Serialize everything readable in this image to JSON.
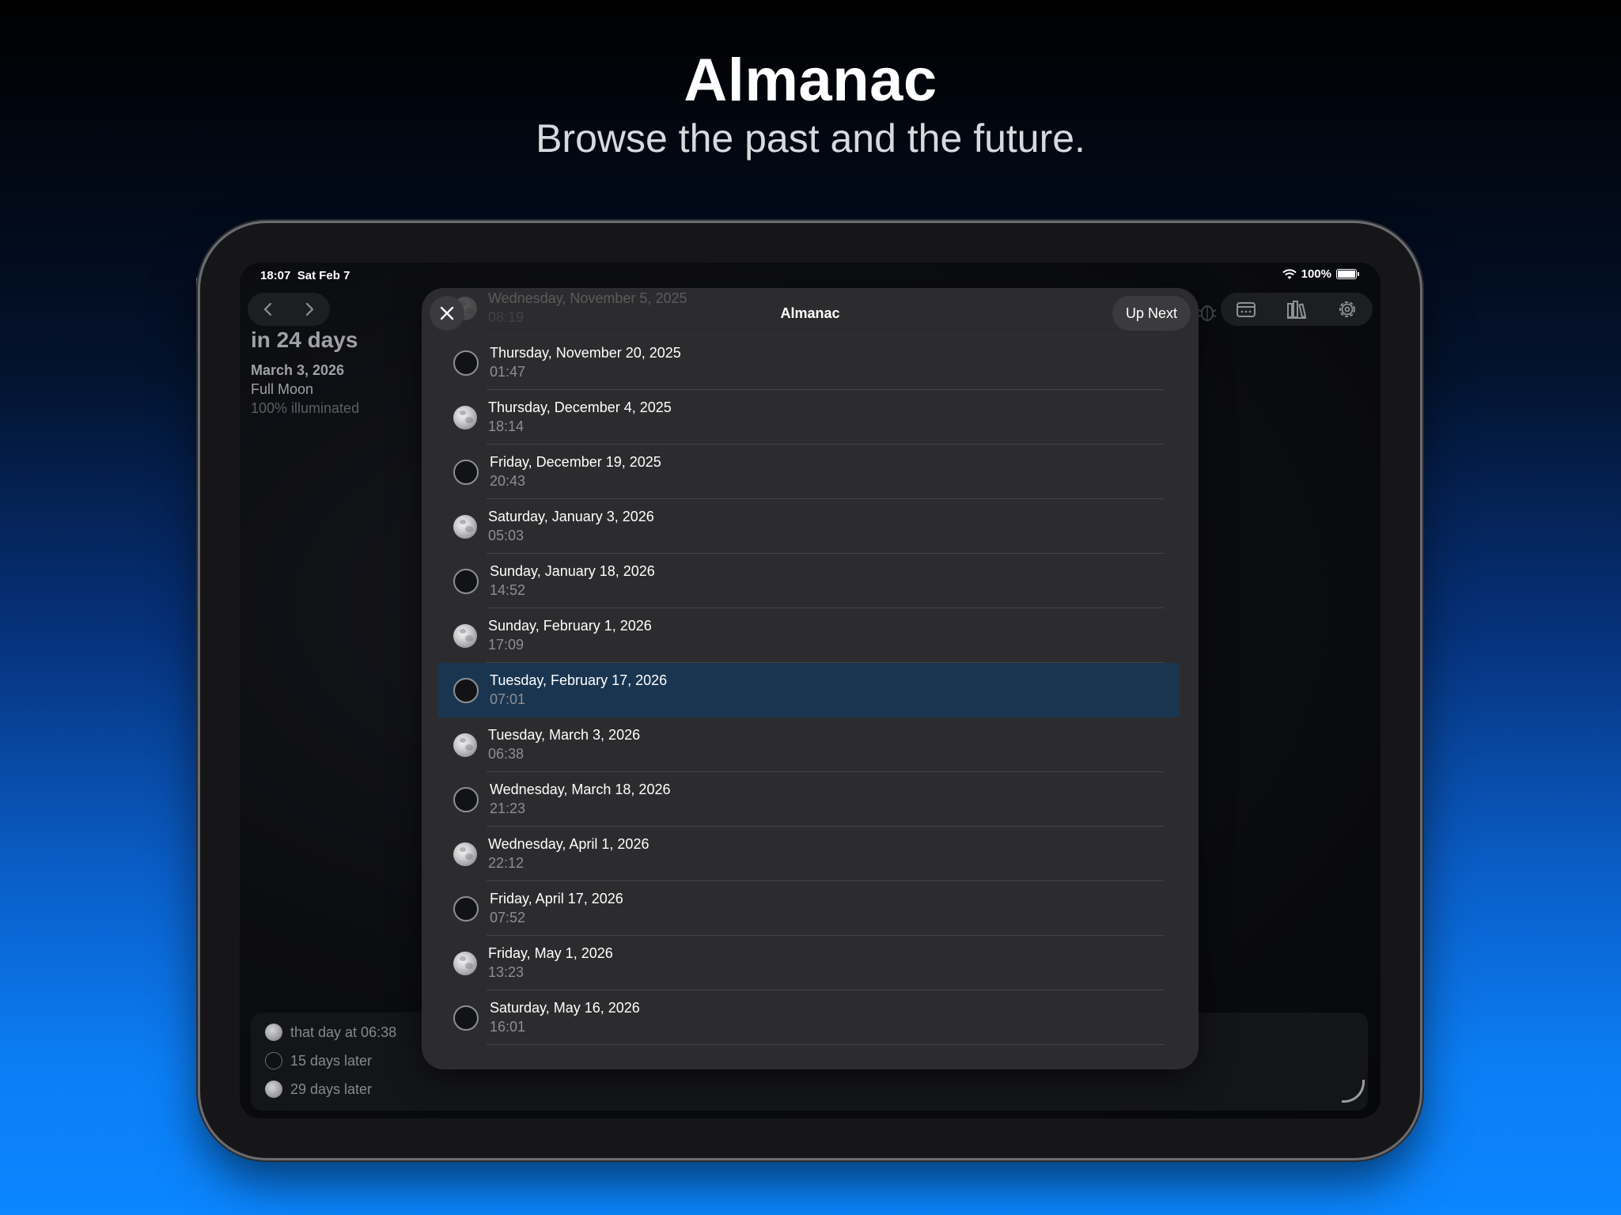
{
  "promo": {
    "title": "Almanac",
    "subtitle": "Browse the past and the future."
  },
  "status_bar": {
    "time": "18:07",
    "date": "Sat Feb 7",
    "battery": "100%"
  },
  "background_view": {
    "countdown": "in 24 days",
    "date": "March 3, 2026",
    "phase": "Full Moon",
    "illumination": "100% illuminated",
    "footer": [
      {
        "icon": "full-moon-icon",
        "label": "that day at 06:38"
      },
      {
        "icon": "new-moon-icon",
        "label": "15 days later"
      },
      {
        "icon": "full-moon-icon",
        "label": "29 days later"
      }
    ]
  },
  "sheet": {
    "title": "Almanac",
    "up_next_label": "Up Next",
    "rows": [
      {
        "date": "Wednesday, November 5, 2025",
        "time": "08:19",
        "phase": "full"
      },
      {
        "date": "Thursday, November 20, 2025",
        "time": "01:47",
        "phase": "new"
      },
      {
        "date": "Thursday, December 4, 2025",
        "time": "18:14",
        "phase": "full"
      },
      {
        "date": "Friday, December 19, 2025",
        "time": "20:43",
        "phase": "new"
      },
      {
        "date": "Saturday, January 3, 2026",
        "time": "05:03",
        "phase": "full"
      },
      {
        "date": "Sunday, January 18, 2026",
        "time": "14:52",
        "phase": "new"
      },
      {
        "date": "Sunday, February 1, 2026",
        "time": "17:09",
        "phase": "full"
      },
      {
        "date": "Tuesday, February 17, 2026",
        "time": "07:01",
        "phase": "new",
        "selected": true
      },
      {
        "date": "Tuesday, March 3, 2026",
        "time": "06:38",
        "phase": "full"
      },
      {
        "date": "Wednesday, March 18, 2026",
        "time": "21:23",
        "phase": "new"
      },
      {
        "date": "Wednesday, April 1, 2026",
        "time": "22:12",
        "phase": "full"
      },
      {
        "date": "Friday, April 17, 2026",
        "time": "07:52",
        "phase": "new"
      },
      {
        "date": "Friday, May 1, 2026",
        "time": "13:23",
        "phase": "full"
      },
      {
        "date": "Saturday, May 16, 2026",
        "time": "16:01",
        "phase": "new"
      }
    ]
  },
  "colors": {
    "selected_row": "#1a3550",
    "sheet_bg": "#2c2c2e",
    "accent_blue": "#0b86ff"
  }
}
